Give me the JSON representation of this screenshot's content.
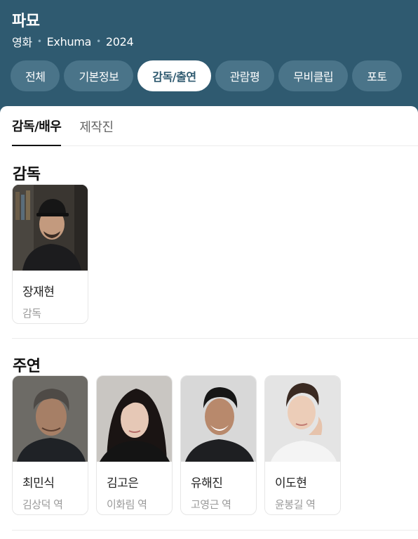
{
  "movie": {
    "title": "파묘",
    "meta": [
      "영화",
      "Exhuma",
      "2024"
    ]
  },
  "tabs": [
    "전체",
    "기본정보",
    "감독/출연",
    "관람평",
    "무비클립",
    "포토"
  ],
  "active_tab": "감독/출연",
  "subtabs": [
    "감독/배우",
    "제작진"
  ],
  "active_subtab": "감독/배우",
  "sections": {
    "director": {
      "title": "감독",
      "people": [
        {
          "name": "장재현",
          "role": "감독"
        }
      ]
    },
    "cast": {
      "title": "주연",
      "people": [
        {
          "name": "최민식",
          "role": "김상덕 역"
        },
        {
          "name": "김고은",
          "role": "이화림 역"
        },
        {
          "name": "유해진",
          "role": "고영근 역"
        },
        {
          "name": "이도현",
          "role": "윤봉길 역"
        }
      ]
    }
  },
  "colors": {
    "header_bg": "#2f5a70",
    "tab_bg": "#4a7489",
    "active_tab_text": "#2f5a70"
  }
}
